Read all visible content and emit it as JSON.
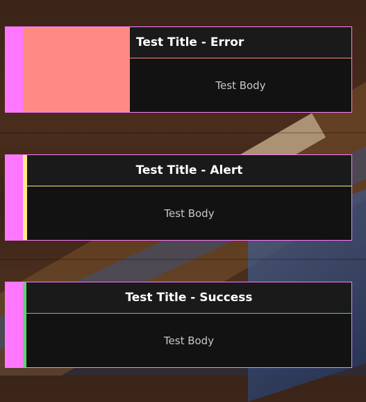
{
  "colors": {
    "sidebar": "#ff77ff",
    "border": "#ff7cff",
    "error": "#ff8a84",
    "alert": "#ffe98a",
    "success": "#5fd36a"
  },
  "toasts": [
    {
      "type": "error",
      "title": "Test Title - Error",
      "body": "Test Body"
    },
    {
      "type": "alert",
      "title": "Test Title - Alert",
      "body": "Test Body"
    },
    {
      "type": "success",
      "title": "Test Title - Success",
      "body": "Test Body"
    }
  ]
}
